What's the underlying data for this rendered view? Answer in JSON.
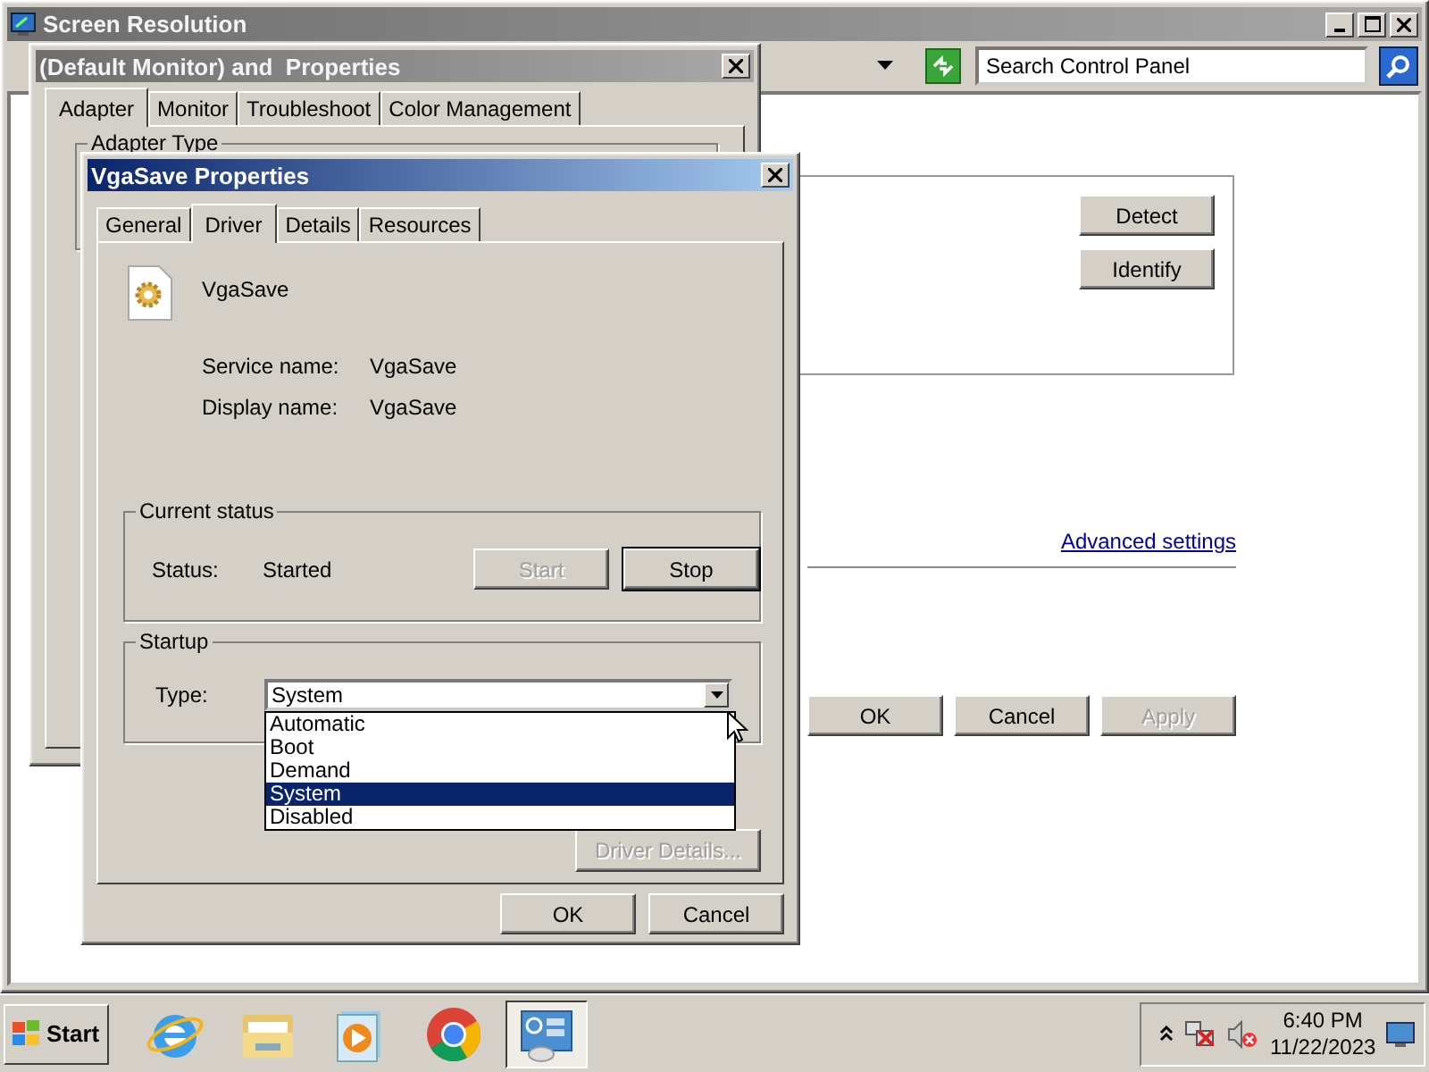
{
  "background_window": {
    "title": "Screen Resolution",
    "search": {
      "placeholder": "Search Control Panel"
    },
    "buttons": [
      {
        "label": "Detect"
      },
      {
        "label": "Identify"
      }
    ],
    "link": "Advanced settings",
    "footer_buttons": [
      {
        "label": "OK",
        "disabled": false
      },
      {
        "label": "Cancel",
        "disabled": false
      },
      {
        "label": "Apply",
        "disabled": true
      }
    ]
  },
  "monitor_dialog": {
    "title": "(Default Monitor) and  Properties",
    "tabs": [
      {
        "label": "Adapter",
        "selected": true
      },
      {
        "label": "Monitor",
        "selected": false
      },
      {
        "label": "Troubleshoot",
        "selected": false
      },
      {
        "label": "Color Management",
        "selected": false
      }
    ],
    "group_title": "Adapter Type"
  },
  "driver_dialog": {
    "title": "VgaSave Properties",
    "tabs": [
      {
        "label": "General",
        "selected": false
      },
      {
        "label": "Driver",
        "selected": true
      },
      {
        "label": "Details",
        "selected": false
      },
      {
        "label": "Resources",
        "selected": false
      }
    ],
    "device_name": "VgaSave",
    "fields": [
      {
        "label": "Service name:",
        "value": "VgaSave"
      },
      {
        "label": "Display name:",
        "value": "VgaSave"
      }
    ],
    "status_group": {
      "title": "Current status",
      "label": "Status:",
      "value": "Started",
      "buttons": [
        {
          "label": "Start",
          "disabled": true,
          "default": false
        },
        {
          "label": "Stop",
          "disabled": false,
          "default": true
        }
      ]
    },
    "startup_group": {
      "title": "Startup",
      "label": "Type:",
      "value": "System",
      "expanded": true,
      "options": [
        {
          "label": "Automatic",
          "selected": false
        },
        {
          "label": "Boot",
          "selected": false
        },
        {
          "label": "Demand",
          "selected": false
        },
        {
          "label": "System",
          "selected": true
        },
        {
          "label": "Disabled",
          "selected": false
        }
      ]
    },
    "details_button": "Driver Details...",
    "buttons": [
      {
        "label": "OK"
      },
      {
        "label": "Cancel"
      }
    ]
  },
  "taskbar": {
    "start": "Start",
    "apps": [
      {
        "kind": "browser",
        "selected": false
      },
      {
        "kind": "folder",
        "selected": false
      },
      {
        "kind": "media",
        "selected": false
      },
      {
        "kind": "chrome",
        "selected": false
      },
      {
        "kind": "control",
        "selected": true
      }
    ],
    "clock": {
      "time": "6:40 PM",
      "date": "11/22/2023"
    }
  }
}
